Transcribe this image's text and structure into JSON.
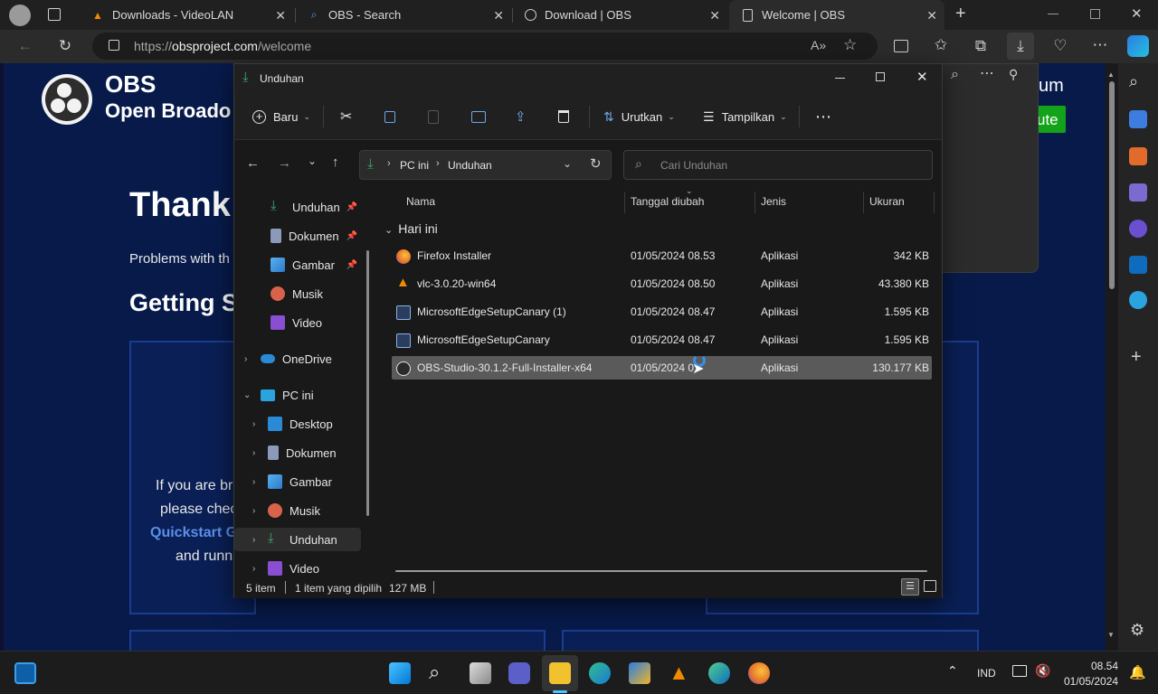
{
  "browser": {
    "tabs": [
      {
        "title": "Downloads - VideoLAN",
        "icon": "vlc-cone-icon"
      },
      {
        "title": "OBS - Search",
        "icon": "search-icon"
      },
      {
        "title": "Download | OBS",
        "icon": "obs-logo-icon"
      },
      {
        "title": "Welcome | OBS",
        "icon": "page-icon"
      }
    ],
    "url_prefix": "https://",
    "url_host": "obsproject.com",
    "url_path": "/welcome",
    "read_aloud_icon": "A»"
  },
  "webpage": {
    "brand_title": "OBS",
    "brand_subtitle": "Open Broado",
    "heading": "Thank",
    "problems_text": "Problems with th",
    "getting_heading": "Getting S",
    "body_line1": "If you are br",
    "body_line2": "please chec",
    "link_text": "Quickstart G",
    "body_line3": "and runn",
    "right_text": "um",
    "right_button": "ute"
  },
  "explorer": {
    "title": "Unduhan",
    "toolbar": {
      "new_label": "Baru",
      "sort_label": "Urutkan",
      "view_label": "Tampilkan"
    },
    "breadcrumb": [
      "PC ini",
      "Unduhan"
    ],
    "search_placeholder": "Cari Unduhan",
    "nav_pinned": [
      {
        "label": "Unduhan",
        "icon": "download-icon",
        "color": "#3fa86b"
      },
      {
        "label": "Dokumen",
        "icon": "document-icon",
        "color": "#8a9ab8"
      },
      {
        "label": "Gambar",
        "icon": "picture-icon",
        "color": "#3d8fd6"
      },
      {
        "label": "Musik",
        "icon": "music-icon",
        "color": "#d9634a"
      },
      {
        "label": "Video",
        "icon": "video-icon",
        "color": "#8a4fd1"
      }
    ],
    "nav_onedrive": "OneDrive",
    "nav_pc": "PC ini",
    "nav_pc_children": [
      {
        "label": "Desktop",
        "icon": "desktop-icon",
        "color": "#2b8ad6"
      },
      {
        "label": "Dokumen",
        "icon": "document-icon",
        "color": "#8a9ab8"
      },
      {
        "label": "Gambar",
        "icon": "picture-icon",
        "color": "#3d8fd6"
      },
      {
        "label": "Musik",
        "icon": "music-icon",
        "color": "#d9634a"
      },
      {
        "label": "Unduhan",
        "icon": "download-icon",
        "color": "#3fa86b"
      },
      {
        "label": "Video",
        "icon": "video-icon",
        "color": "#8a4fd1"
      }
    ],
    "columns": {
      "name": "Nama",
      "date": "Tanggal diubah",
      "type": "Jenis",
      "size": "Ukuran"
    },
    "group_label": "Hari ini",
    "files": [
      {
        "name": "Firefox Installer",
        "date": "01/05/2024 08.53",
        "type": "Aplikasi",
        "size": "342 KB",
        "icon": "firefox-icon",
        "color": "#e8762b"
      },
      {
        "name": "vlc-3.0.20-win64",
        "date": "01/05/2024 08.50",
        "type": "Aplikasi",
        "size": "43.380 KB",
        "icon": "vlc-cone-icon",
        "color": "#f08a00"
      },
      {
        "name": "MicrosoftEdgeSetupCanary (1)",
        "date": "01/05/2024 08.47",
        "type": "Aplikasi",
        "size": "1.595 KB",
        "icon": "installer-icon",
        "color": "#6b8fd1"
      },
      {
        "name": "MicrosoftEdgeSetupCanary",
        "date": "01/05/2024 08.47",
        "type": "Aplikasi",
        "size": "1.595 KB",
        "icon": "installer-icon",
        "color": "#6b8fd1"
      },
      {
        "name": "OBS-Studio-30.1.2-Full-Installer-x64",
        "date": "01/05/2024 0",
        "type": "Aplikasi",
        "size": "130.177 KB",
        "icon": "obs-logo-icon",
        "color": "#333333"
      }
    ],
    "status": {
      "count": "5 item",
      "selected": "1 item yang dipilih",
      "size": "127 MB"
    }
  },
  "taskbar": {
    "lang": "IND",
    "time": "08.54",
    "date": "01/05/2024"
  },
  "colors": {
    "accent_blue": "#3a7bd5",
    "web_bg": "#071a4a",
    "selection": "#5a5a5a",
    "green_button": "#12a31a"
  }
}
